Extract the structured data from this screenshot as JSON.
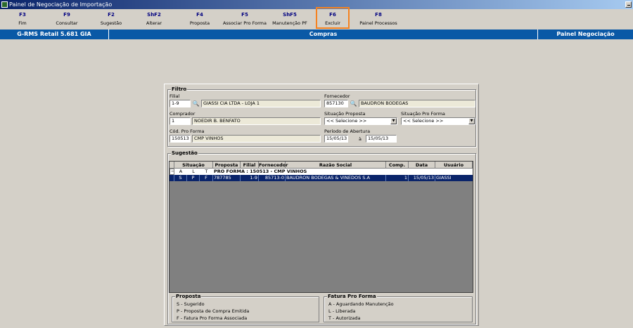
{
  "window": {
    "title": "Painel de Negociação de Importação"
  },
  "toolbar": {
    "items": [
      {
        "key": "F3",
        "label": "Fim"
      },
      {
        "key": "F9",
        "label": "Consultar"
      },
      {
        "key": "F2",
        "label": "Sugestão"
      },
      {
        "key": "ShF2",
        "label": "Alterar"
      },
      {
        "key": "F4",
        "label": "Proposta"
      },
      {
        "key": "F5",
        "label": "Associar Pro Forma"
      },
      {
        "key": "ShF5",
        "label": "Manutenção PF"
      },
      {
        "key": "F6",
        "label": "Excluir"
      },
      {
        "key": "F8",
        "label": "Painel Processos"
      }
    ]
  },
  "infobar": {
    "left": "G-RMS Retail 5.681 GIA",
    "center": "Compras",
    "right": "Painel Negociação"
  },
  "filtro": {
    "title": "Filtro",
    "filial_label": "Filial",
    "filial_code": "1-9",
    "filial_name": "GIASSI  CIA LTDA - LOJA 1",
    "fornecedor_label": "Fornecedor",
    "fornecedor_code": "857130",
    "fornecedor_name": "BAUDRON BODEGAS",
    "comprador_label": "Comprador",
    "comprador_code": "1",
    "comprador_name": "NOEDIR B. BENFATO",
    "situacao_proposta_label": "Situação Proposta",
    "situacao_proposta_value": "<< Selecione >>",
    "situacao_proforma_label": "Situação Pro Forma",
    "situacao_proforma_value": "<< Selecione >>",
    "cod_proforma_label": "Cód. Pro Forma",
    "cod_proforma_code": "150513",
    "cod_proforma_name": "CMP VINHOS",
    "periodo_label": "Período de Abertura",
    "periodo_inicio": "15/05/13",
    "periodo_sep": "à",
    "periodo_fim": "15/05/13"
  },
  "sugestao": {
    "title": "Sugestão",
    "columns": [
      "",
      "Situação",
      "Proposta",
      "Filial",
      "Fornecedor",
      "Razão Social",
      "Comp.",
      "Data",
      "Usuário"
    ],
    "group_row": {
      "expander": "−",
      "a": "A",
      "l": "L",
      "t": "T",
      "label": "PRO FORMA : 150513 - CMP VINHOS"
    },
    "rows": [
      {
        "s": "S",
        "p": "P",
        "f": "F",
        "proposta": "787785",
        "filial": "1-9",
        "fornecedor": "85713-0",
        "razao": "BAUDRON BODEGAS & VINEDOS S.A",
        "comp": "1",
        "data": "15/05/13",
        "usuario": "GIASSI"
      }
    ]
  },
  "legend_proposta": {
    "title": "Proposta",
    "lines": [
      "S - Sugerido",
      "P - Proposta de Compra Emitida",
      "F - Fatura Pro Forma Associada"
    ]
  },
  "legend_proforma": {
    "title": "Fatura Pro Forma",
    "lines": [
      "A - Aguardando Manutenção",
      "L - Liberada",
      "T - Autorizada"
    ]
  }
}
